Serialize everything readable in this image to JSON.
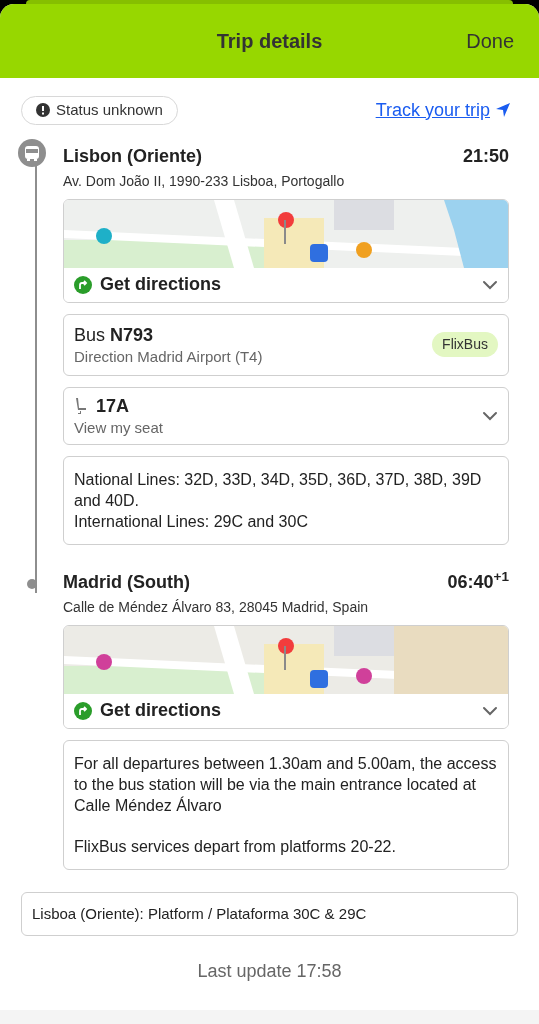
{
  "header": {
    "title": "Trip details",
    "done": "Done"
  },
  "status": {
    "label": "Status unknown"
  },
  "track": {
    "label": "Track your trip"
  },
  "stops": [
    {
      "kind": "origin",
      "name": "Lisbon (Oriente)",
      "time": "21:50",
      "address": "Av. Dom João II, 1990-233 Lisboa, Portogallo",
      "directions": "Get directions",
      "cards": [
        {
          "kind": "bus",
          "title": "Bus **N793**",
          "subtitle": "Direction Madrid Airport (T4)",
          "badge": "FlixBus"
        },
        {
          "kind": "seat",
          "title": "17A",
          "subtitle": "View my seat"
        },
        {
          "kind": "note",
          "paragraphs": [
            "National Lines: 32D, 33D, 34D, 35D, 36D, 37D, 38D, 39D and 40D.\nInternational Lines: 29C and 30C"
          ]
        }
      ]
    },
    {
      "kind": "destination",
      "name": "Madrid (South)",
      "time": "06:40$^{+1}$",
      "address": "Calle de Méndez Álvaro 83, 28045 Madrid, Spain",
      "directions": "Get directions",
      "cards": [
        {
          "kind": "note",
          "paragraphs": [
            "For all departures between 1.30am and 5.00am, the access to the bus station will be via the main entrance located at Calle Méndez Álvaro",
            "FlixBus services depart from platforms 20-22."
          ]
        }
      ]
    }
  ],
  "platform_note": "Lisboa (Oriente): Platform / Plataforma 30C & 29C",
  "last_update": "Last update 17:58"
}
